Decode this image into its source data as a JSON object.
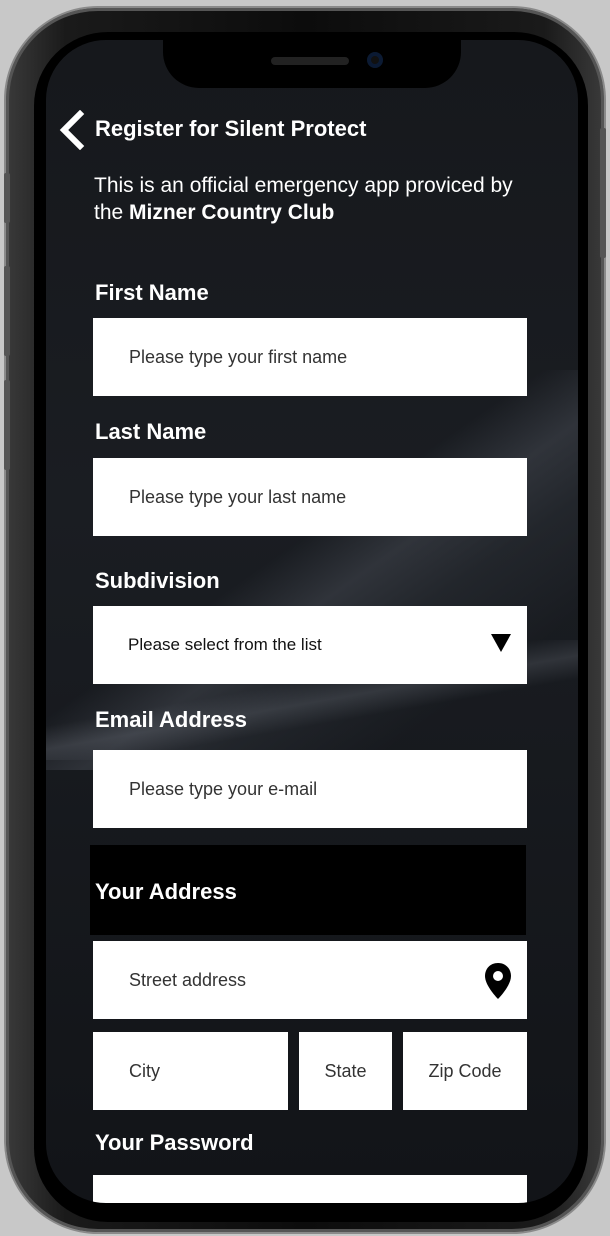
{
  "header": {
    "back_icon": "chevron-left-icon",
    "title": "Register for Silent Protect"
  },
  "intro": {
    "text": "This is an official emergency app proviced by the ",
    "club": "Mizner Country Club"
  },
  "form": {
    "first_name": {
      "label": "First Name",
      "placeholder": "Please type your first name"
    },
    "last_name": {
      "label": "Last Name",
      "placeholder": "Please type your last name"
    },
    "subdivision": {
      "label": "Subdivision",
      "placeholder": "Please select from the list"
    },
    "email": {
      "label": "Email Address",
      "placeholder": "Please type your e-mail"
    },
    "address": {
      "label": "Your Address",
      "street": "Street address",
      "city": "City",
      "state": "State",
      "zip": "Zip Code"
    },
    "password": {
      "label": "Your Password"
    }
  }
}
